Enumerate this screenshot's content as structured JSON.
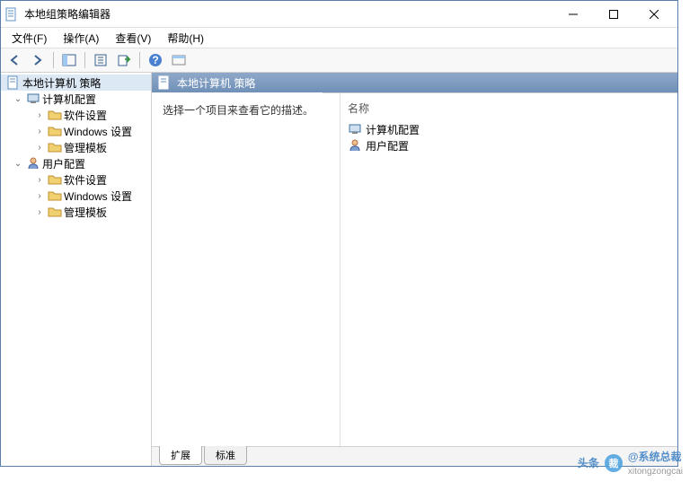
{
  "window": {
    "title": "本地组策略编辑器"
  },
  "menu": {
    "file": "文件(F)",
    "action": "操作(A)",
    "view": "查看(V)",
    "help": "帮助(H)"
  },
  "tree": {
    "root": "本地计算机 策略",
    "computer": "计算机配置",
    "user": "用户配置",
    "software": "软件设置",
    "windows": "Windows 设置",
    "templates": "管理模板"
  },
  "right": {
    "header": "本地计算机 策略",
    "desc": "选择一个项目来查看它的描述。",
    "name_col": "名称",
    "items": {
      "computer": "计算机配置",
      "user": "用户配置"
    }
  },
  "tabs": {
    "extended": "扩展",
    "standard": "标准"
  },
  "watermark": {
    "head": "头条",
    "brand": "@系统总裁",
    "sub": "xitongzongcai"
  }
}
